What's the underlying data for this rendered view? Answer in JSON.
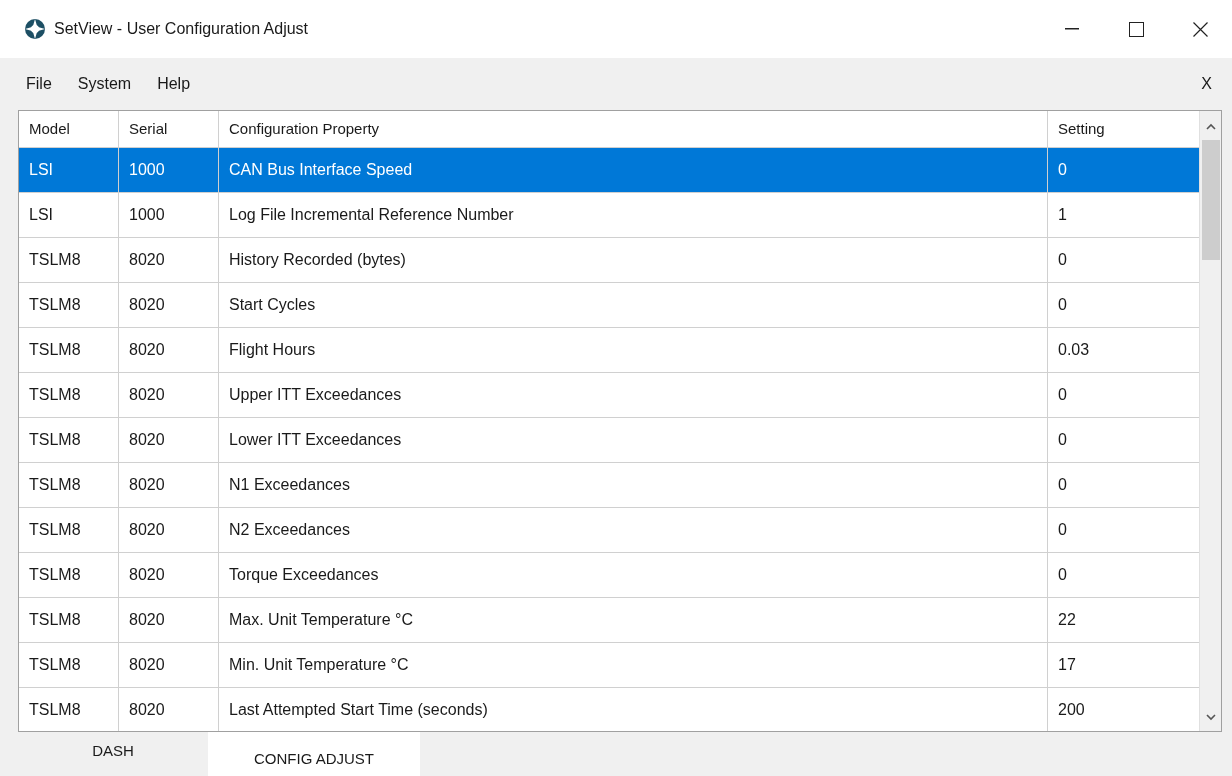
{
  "window": {
    "title": "SetView - User Configuration Adjust"
  },
  "menu": {
    "items": [
      "File",
      "System",
      "Help"
    ],
    "close_label": "X"
  },
  "table": {
    "columns": [
      "Model",
      "Serial",
      "Configuration Property",
      "Setting"
    ],
    "rows": [
      {
        "cells": [
          "LSI",
          "1000",
          "CAN Bus Interface Speed",
          "0"
        ],
        "selected": true
      },
      {
        "cells": [
          "LSI",
          "1000",
          "Log File Incremental Reference Number",
          "1"
        ],
        "selected": false
      },
      {
        "cells": [
          "TSLM8",
          "8020",
          "History Recorded (bytes)",
          "0"
        ],
        "selected": false
      },
      {
        "cells": [
          "TSLM8",
          "8020",
          "Start Cycles",
          "0"
        ],
        "selected": false
      },
      {
        "cells": [
          "TSLM8",
          "8020",
          "Flight Hours",
          "0.03"
        ],
        "selected": false
      },
      {
        "cells": [
          "TSLM8",
          "8020",
          "Upper ITT Exceedances",
          "0"
        ],
        "selected": false
      },
      {
        "cells": [
          "TSLM8",
          "8020",
          "Lower ITT Exceedances",
          "0"
        ],
        "selected": false
      },
      {
        "cells": [
          "TSLM8",
          "8020",
          "N1 Exceedances",
          "0"
        ],
        "selected": false
      },
      {
        "cells": [
          "TSLM8",
          "8020",
          "N2 Exceedances",
          "0"
        ],
        "selected": false
      },
      {
        "cells": [
          "TSLM8",
          "8020",
          "Torque Exceedances",
          "0"
        ],
        "selected": false
      },
      {
        "cells": [
          "TSLM8",
          "8020",
          "Max. Unit Temperature °C",
          "22"
        ],
        "selected": false
      },
      {
        "cells": [
          "TSLM8",
          "8020",
          "Min. Unit Temperature °C",
          "17"
        ],
        "selected": false
      },
      {
        "cells": [
          "TSLM8",
          "8020",
          "Last Attempted Start Time (seconds)",
          "200"
        ],
        "selected": false
      }
    ]
  },
  "tabs": [
    {
      "label": "DASH",
      "selected": false
    },
    {
      "label": "CONFIG ADJUST",
      "selected": true
    }
  ]
}
